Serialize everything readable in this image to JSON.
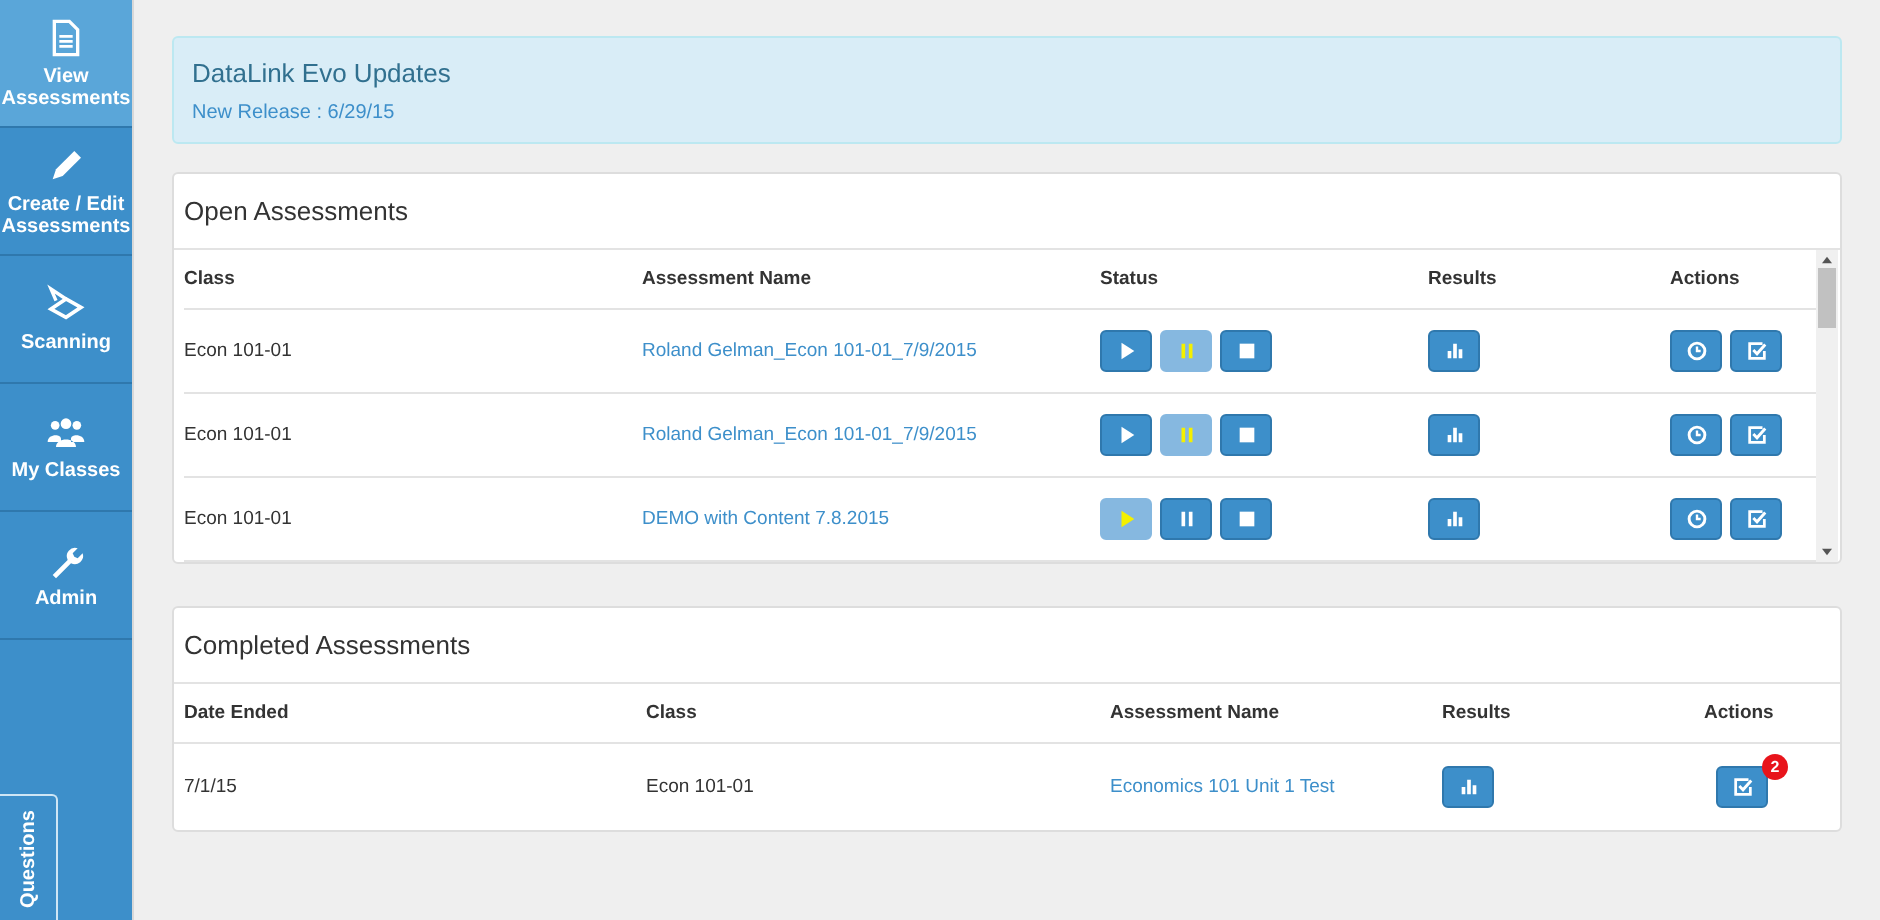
{
  "sidebar": {
    "items": [
      {
        "label": "View Assessments",
        "selected": true
      },
      {
        "label": "Create / Edit Assessments",
        "selected": false
      },
      {
        "label": "Scanning",
        "selected": false
      },
      {
        "label": "My Classes",
        "selected": false
      },
      {
        "label": "Admin",
        "selected": false
      }
    ],
    "questions_tab": "Questions"
  },
  "updates": {
    "title": "DataLink Evo Updates",
    "release": "New Release : 6/29/15"
  },
  "open_assessments": {
    "title": "Open Assessments",
    "columns": [
      "Class",
      "Assessment Name",
      "Status",
      "Results",
      "Actions"
    ],
    "rows": [
      {
        "class": "Econ 101-01",
        "name": "Roland Gelman_Econ 101-01_7/9/2015",
        "status": [
          {
            "kind": "play",
            "highlighted": false
          },
          {
            "kind": "pause",
            "highlighted": true
          },
          {
            "kind": "stop",
            "highlighted": false
          }
        ]
      },
      {
        "class": "Econ 101-01",
        "name": "Roland Gelman_Econ 101-01_7/9/2015",
        "status": [
          {
            "kind": "play",
            "highlighted": false
          },
          {
            "kind": "pause",
            "highlighted": true
          },
          {
            "kind": "stop",
            "highlighted": false
          }
        ]
      },
      {
        "class": "Econ 101-01",
        "name": "DEMO with Content 7.8.2015",
        "status": [
          {
            "kind": "play",
            "highlighted": true
          },
          {
            "kind": "pause",
            "highlighted": false
          },
          {
            "kind": "stop",
            "highlighted": false
          }
        ]
      }
    ]
  },
  "completed_assessments": {
    "title": "Completed Assessments",
    "columns": [
      "Date Ended",
      "Class",
      "Assessment Name",
      "Results",
      "Actions"
    ],
    "rows": [
      {
        "date": "7/1/15",
        "class": "Econ 101-01",
        "name": "Economics 101 Unit 1 Test",
        "badge": "2"
      }
    ]
  }
}
